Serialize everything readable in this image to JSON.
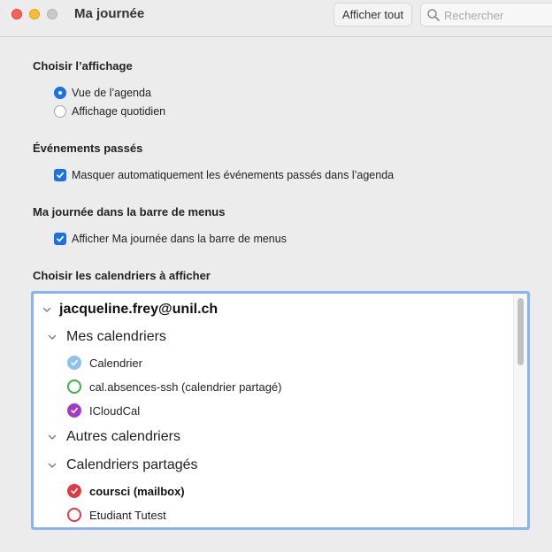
{
  "window": {
    "title": "Ma journée",
    "show_all_label": "Afficher tout",
    "search_placeholder": "Rechercher"
  },
  "display_section": {
    "title": "Choisir l’affichage",
    "options": [
      {
        "label": "Vue de l’agenda",
        "selected": true
      },
      {
        "label": "Affichage quotidien",
        "selected": false
      }
    ]
  },
  "past_events_section": {
    "title": "Événements passés",
    "checkbox_label": "Masquer automatiquement les événements passés dans l’agenda",
    "checked": true
  },
  "menubar_section": {
    "title": "Ma journée dans la barre de menus",
    "checkbox_label": "Afficher Ma journée dans la barre de menus",
    "checked": true
  },
  "calendars_section": {
    "title": "Choisir les calendriers à afficher",
    "account": "jacqueline.frey@unil.ch",
    "groups": {
      "mine": "Mes calendriers",
      "other": "Autres calendriers",
      "shared": "Calendriers partagés"
    },
    "calendars": [
      {
        "label": "Calendrier",
        "color": "#8ec2ee",
        "checked": true,
        "bold": false
      },
      {
        "label": "cal.absences-ssh (calendrier partagé)",
        "color": "#3fb049",
        "checked": false,
        "bold": false
      },
      {
        "label": "ICloudCal",
        "color": "#a23bc4",
        "checked": true,
        "bold": false
      },
      {
        "label": "coursci (mailbox)",
        "color": "#dc3c44",
        "checked": true,
        "bold": true
      },
      {
        "label": "Etudiant Tutest",
        "color": "#dc3c44",
        "checked": false,
        "bold": false
      }
    ]
  },
  "colors": {
    "accent": "#1a73e8",
    "list_focus_border": "#8ab4f0"
  }
}
